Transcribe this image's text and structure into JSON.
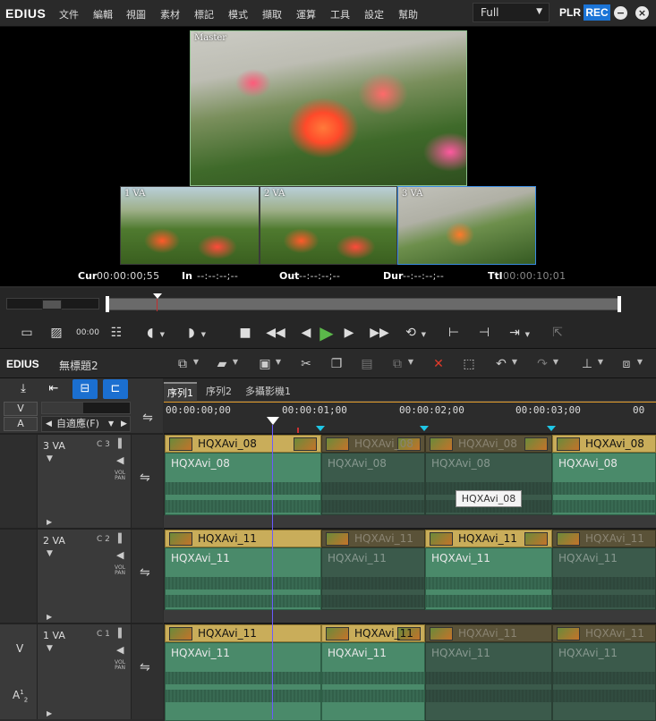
{
  "app": {
    "logo": "EDIUS"
  },
  "menu": [
    "文件",
    "編輯",
    "視圖",
    "素材",
    "標記",
    "模式",
    "擷取",
    "運算",
    "工具",
    "設定",
    "幫助"
  ],
  "display_mode": {
    "value": "Full"
  },
  "window_controls": {
    "plr": "PLR",
    "rec": "REC",
    "minimize": "−",
    "close": "×"
  },
  "preview": {
    "master_label": "Master",
    "pip_labels": [
      "1 VA",
      "2 VA",
      "3 VA"
    ]
  },
  "timecodes": {
    "cur_label": "Cur",
    "cur": "00:00:00;55",
    "in_label": "In",
    "in": "--:--:--;--",
    "out_label": "Out",
    "out": "--:--:--;--",
    "dur_label": "Dur",
    "dur": "--:--:--;--",
    "ttl_label": "Ttl",
    "ttl": "00:00:10;01"
  },
  "transport": {
    "timecode_btn": "00:00"
  },
  "timeline": {
    "logo": "EDIUS",
    "project": "無標題2",
    "zoom": "自適應(F)",
    "v_label": "V",
    "a_label": "A",
    "tabs": [
      "序列1",
      "序列2",
      "多攝影機1"
    ],
    "ruler_ticks": [
      "00:00:00;00",
      "00:00:01;00",
      "00:00:02;00",
      "00:00:03;00",
      "00"
    ],
    "tooltip": "HQXAvi_08"
  },
  "tracks": [
    {
      "name": "3 VA",
      "channel": "C 3",
      "clips": [
        "HQXAvi_08",
        "HQXAvi_08",
        "HQXAvi_08",
        "HQXAvi_08"
      ],
      "body": [
        "HQXAvi_08",
        "HQXAvi_08",
        "HQXAvi_08",
        "HQXAvi_08"
      ]
    },
    {
      "name": "2 VA",
      "channel": "C 2",
      "clips": [
        "HQXAvi_11",
        "HQXAvi_11",
        "HQXAvi_11",
        "HQXAvi_11"
      ],
      "body": [
        "HQXAvi_11",
        "HQXAvi_11",
        "HQXAvi_11",
        "HQXAvi_11"
      ]
    },
    {
      "name": "1 VA",
      "channel": "C 1",
      "clips": [
        "HQXAvi_11",
        "HQXAvi_11",
        "HQXAvi_11",
        "HQXAvi_11"
      ],
      "body": [
        "HQXAvi_11",
        "HQXAvi_11",
        "HQXAvi_11",
        "HQXAvi_11"
      ],
      "left_v": "V",
      "left_a": "A",
      "left_a_sup": "1",
      "left_a_sub": "2"
    }
  ],
  "colors": {
    "accent": "#1b74d6",
    "clip_header": "#c9ad5a",
    "clip_body": "#4a8a6a",
    "cue": "#1fc6e6",
    "play": "#5bb74a"
  }
}
